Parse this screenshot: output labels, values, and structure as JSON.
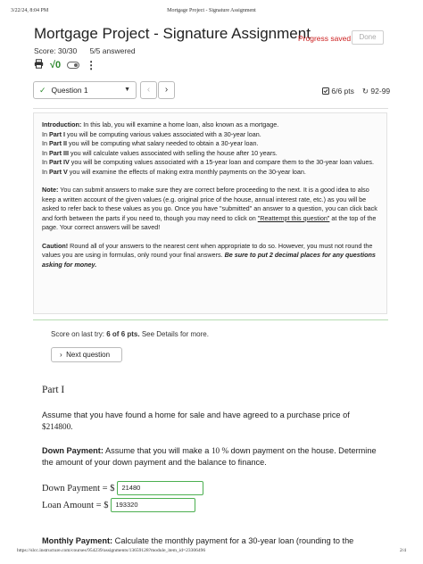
{
  "print_header": {
    "datetime": "3/22/24, 8:04 PM",
    "page_title": "Mortgage Project - Signature Assignment"
  },
  "header": {
    "title": "Mortgage Project - Signature Assignment",
    "progress_status": "Progress saved",
    "done_label": "Done",
    "score": "Score: 30/30",
    "answered": "5/5 answered"
  },
  "icons": {
    "print": "print-icon",
    "math": "square-root-icon",
    "toggle": "toggle-icon",
    "more": "kebab-menu-icon"
  },
  "question_nav": {
    "selected_question": "Question 1",
    "prev_glyph": "‹",
    "next_glyph": "›",
    "points": "6/6 pts",
    "attempts": "92-99"
  },
  "intro": {
    "intro_label": "Introduction:",
    "intro_text": " In this lab, you will examine a home loan, also known as a mortgage.",
    "parts": [
      {
        "pre": "In ",
        "label": "Part I",
        "post": " you will be computing various values associated with a 30-year loan."
      },
      {
        "pre": "In ",
        "label": "Part II",
        "post": " you will be computing what salary needed to obtain a 30-year loan."
      },
      {
        "pre": "In ",
        "label": "Part III",
        "post": " you will calculate values associated with selling the house after 10 years."
      },
      {
        "pre": "In ",
        "label": "Part IV",
        "post": " you will be computing values associated with a 15-year loan and compare them to the 30-year loan values."
      },
      {
        "pre": "In ",
        "label": "Part V",
        "post": " you will examine the effects of making extra monthly payments on the 30-year loan."
      }
    ],
    "note_label": "Note:",
    "note_text": " You can submit answers to make sure they are correct before proceeding to the next. It is a good idea to also keep a written account of the given values (e.g. original price of the house, annual interest rate, etc.) as you will be asked to refer back to these values as you go. Once you have \"submitted\" an answer to a question, you can click back and forth between the parts if you need to, though you may need to click on ",
    "note_link": "\"Reattempt this question\"",
    "note_tail": " at the top of the page. Your correct answers will be saved!",
    "caution_label": "Caution!",
    "caution_text": " Round all of your answers to the nearest cent when appropriate to do so. However, you must not round the values you are using in formulas, only round your final answers. ",
    "caution_emphasis": "Be sure to put 2 decimal places for any questions asking for money."
  },
  "last_try": {
    "prefix": "Score on last try: ",
    "score": "6 of 6 pts.",
    "suffix": " See Details for more."
  },
  "next_question_label": "Next question",
  "part1": {
    "title": "Part I",
    "scenario_text": "Assume that you have found a home for sale and have agreed to a purchase price of ",
    "price": "$214800.",
    "down_label": "Down Payment:",
    "down_text_a": " Assume that you will make a ",
    "down_percent": "10 %",
    "down_text_b": " down payment on the house. Determine the amount of your down payment and the balance to finance.",
    "down_payment_label": "Down Payment = $",
    "down_payment_value": "21480",
    "loan_amount_label": "Loan Amount = $",
    "loan_amount_value": "193320",
    "monthly_label": "Monthly Payment:",
    "monthly_text": " Calculate the monthly payment for a 30-year loan (rounding to the"
  },
  "print_footer": {
    "url": "https://slcc.instructure.com/courses/954239/assignments/13659128?module_item_id=23306496",
    "page": "2/4"
  }
}
